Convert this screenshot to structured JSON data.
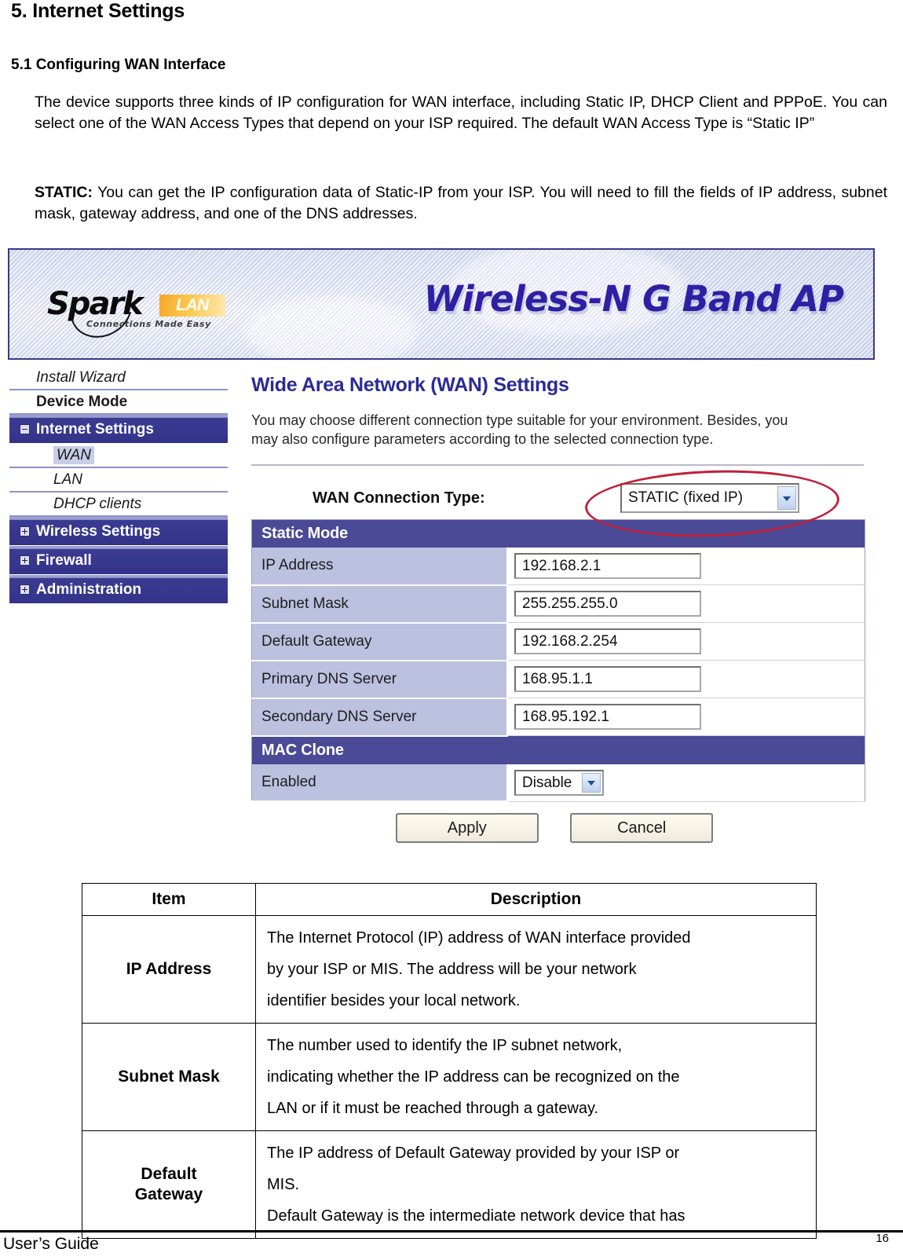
{
  "document": {
    "heading1": "5. Internet Settings",
    "heading2": "5.1 Configuring WAN Interface",
    "paragraph1": "The device supports three kinds of IP configuration for WAN interface, including Static IP, DHCP Client and PPPoE. You can select one of the WAN Access Types that depend on your ISP required. The default WAN Access Type is “Static IP”",
    "paragraph2_lead": "STATIC:",
    "paragraph2": " You can get the IP configuration data of Static-IP from your ISP. You will need to fill the fields of IP address, subnet mask, gateway address, and one of the DNS addresses."
  },
  "banner": {
    "logo_main": "Spark",
    "logo_badge": "LAN",
    "logo_tagline": "Connections Made Easy",
    "product_title": "Wireless-N G Band AP",
    "title_color": "#2f1fa5",
    "badge_color": "#f7a72a"
  },
  "sidebar": {
    "items": [
      {
        "label": "Install Wizard",
        "type": "plain",
        "icon": "none"
      },
      {
        "label": "Device Mode",
        "type": "plain-bold",
        "icon": "none"
      },
      {
        "label": "Internet Settings",
        "type": "group",
        "icon": "minus-box-icon",
        "expanded": true
      },
      {
        "label": "WAN",
        "type": "sub",
        "selected": true
      },
      {
        "label": "LAN",
        "type": "sub",
        "selected": false
      },
      {
        "label": "DHCP clients",
        "type": "sub",
        "selected": false
      },
      {
        "label": "Wireless Settings",
        "type": "group",
        "icon": "plus-box-icon",
        "expanded": false
      },
      {
        "label": "Firewall",
        "type": "group",
        "icon": "plus-box-icon",
        "expanded": false
      },
      {
        "label": "Administration",
        "type": "group",
        "icon": "plus-box-icon",
        "expanded": false
      }
    ],
    "group_color": "#3b3b92",
    "selected_color": "#c8cde8"
  },
  "main": {
    "title": "Wide Area Network (WAN) Settings",
    "description": "You may choose different connection type suitable for your environment. Besides, you may also configure parameters according to the selected connection type.",
    "connection_type_label": "WAN Connection Type:",
    "connection_type_value": "STATIC (fixed IP)",
    "annotation_color": "#c0203a",
    "static_section_title": "Static Mode",
    "static_fields": [
      {
        "label": "IP Address",
        "value": "192.168.2.1"
      },
      {
        "label": "Subnet Mask",
        "value": "255.255.255.0"
      },
      {
        "label": "Default Gateway",
        "value": "192.168.2.254"
      },
      {
        "label": "Primary DNS Server",
        "value": "168.95.1.1"
      },
      {
        "label": "Secondary DNS Server",
        "value": "168.95.192.1"
      }
    ],
    "mac_clone_section_title": "MAC Clone",
    "mac_clone_label": "Enabled",
    "mac_clone_value": "Disable",
    "apply_button": "Apply",
    "cancel_button": "Cancel"
  },
  "desc_table": {
    "header_item": "Item",
    "header_description": "Description",
    "rows": [
      {
        "item": "IP Address",
        "lines": [
          "The Internet Protocol (IP) address of WAN interface provided",
          "by your ISP or MIS. The address will be your network",
          "identifier besides your local network."
        ]
      },
      {
        "item": "Subnet Mask",
        "lines": [
          "The number used to identify the IP subnet network,",
          "indicating whether the IP address can be recognized on the",
          "LAN or if it must be reached through a gateway."
        ]
      },
      {
        "item": "Default Gateway",
        "lines": [
          "The IP address of Default Gateway provided by your ISP or",
          "MIS.",
          "Default Gateway is the intermediate network device that has"
        ]
      }
    ]
  },
  "footer": {
    "left": "User’s Guide",
    "page_number": "16"
  }
}
